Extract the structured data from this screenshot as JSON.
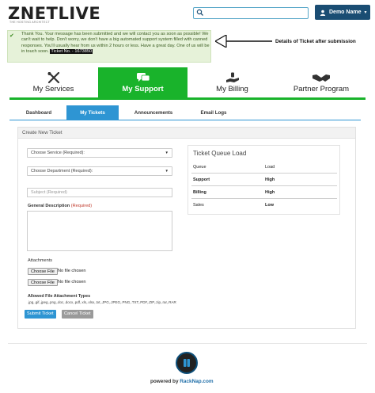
{
  "header": {
    "logo": "ZNETLIVE",
    "logo_tagline": "THE HOSTING ARCHITECT",
    "search": {
      "placeholder": "",
      "value": ""
    },
    "user_menu_label": "Demo Name"
  },
  "alert": {
    "message": "Thank You. Your message has been submitted and we will contact you as soon as possible! We can't wait to help. Don't worry, we don't have a big automated support system filled with canned responses. You'll usually hear from us within 2 hours or less. Have a great day. One of us will be in touch soon.",
    "ticket_label": "Ticket No. - 1673850",
    "annotation": "Details of Ticket after submission"
  },
  "nav": [
    {
      "label": "My Services",
      "icon": "tools-icon",
      "active": false
    },
    {
      "label": "My Support",
      "icon": "chat-icon",
      "active": true
    },
    {
      "label": "My Billing",
      "icon": "billing-icon",
      "active": false
    },
    {
      "label": "Partner Program",
      "icon": "handshake-icon",
      "active": false
    }
  ],
  "tabs": [
    {
      "label": "Dashboard",
      "active": false
    },
    {
      "label": "My Tickets",
      "active": true
    },
    {
      "label": "Announcements",
      "active": false
    },
    {
      "label": "Email Logs",
      "active": false
    }
  ],
  "form": {
    "title": "Create New Ticket",
    "service_select": "Choose Service (Required):",
    "department_select": "Choose Department (Required):",
    "subject_placeholder": "Subject (Required)",
    "description_label": "General Description",
    "description_required": "(Required)",
    "attachments_label": "Attachments",
    "file_button": "Choose File",
    "file_none": "No file chosen",
    "allowed_label": "Allowed File Attachment Types",
    "allowed_types": ".jpg,.gif,.jpeg,.png,.doc,.docx,.pdf,.xls,.xlsx,.txt,.JPG,.JPEG,.PNG,.TXT,.PDF,.ZIP,.zip,.rar,.RAR",
    "submit_label": "Submit Ticket",
    "cancel_label": "Cancel Ticket"
  },
  "queue": {
    "title": "Ticket Queue Load",
    "headers": [
      "Queue",
      "Load"
    ],
    "rows": [
      {
        "queue": "Support",
        "load": "High"
      },
      {
        "queue": "Billing",
        "load": "High"
      },
      {
        "queue": "Sales",
        "load": "Low"
      }
    ]
  },
  "footer": {
    "powered_by": "powered by",
    "brand": "RackNap.com"
  },
  "colors": {
    "accent_green": "#19b32b",
    "accent_blue": "#2e95d3",
    "header_blue": "#1a4d73"
  }
}
